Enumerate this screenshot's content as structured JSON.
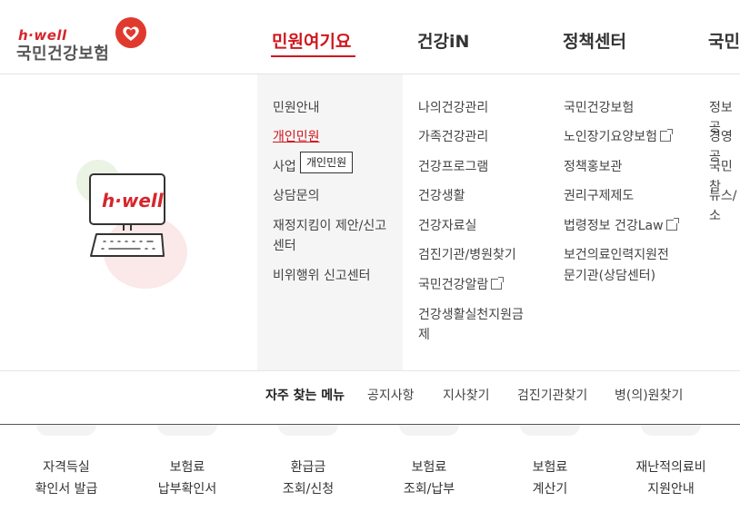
{
  "logo": {
    "sub": "h·well",
    "main": "국민건강보험"
  },
  "gnb": [
    {
      "label": "민원여기요"
    },
    {
      "label": "건강iN"
    },
    {
      "label": "정책센터"
    },
    {
      "label": "국민"
    }
  ],
  "menu": {
    "col1": [
      "민원안내",
      "개인민원",
      "사업",
      "상담문의",
      "재정지킴이 제안/신고",
      "센터",
      "비위행위 신고센터"
    ],
    "col2": [
      "나의건강관리",
      "가족건강관리",
      "건강프로그램",
      "건강생활",
      "건강자료실",
      "검진기관/병원찾기",
      "국민건강알람",
      "건강생활실천지원금",
      "제"
    ],
    "col3": [
      "국민건강보험",
      "노인장기요양보험",
      "정책홍보관",
      "권리구제제도",
      "법령정보 건강Law",
      "보건의료인력지원전",
      "문기관(상담센터)"
    ],
    "col4": [
      "정보공",
      "경영공",
      "국민참",
      "뉴스/소"
    ]
  },
  "tooltip": "개인민원",
  "illustration": {
    "screen_text": "h·well"
  },
  "quick": {
    "title": "자주 찾는 메뉴",
    "links": [
      "공지사항",
      "지사찾기",
      "검진기관찾기",
      "병(의)원찾기"
    ]
  },
  "services": [
    {
      "line1": "자격득실",
      "line2": "확인서 발급"
    },
    {
      "line1": "보험료",
      "line2": "납부확인서"
    },
    {
      "line1": "환급금",
      "line2": "조회/신청"
    },
    {
      "line1": "보험료",
      "line2": "조회/납부"
    },
    {
      "line1": "보험료",
      "line2": "계산기"
    },
    {
      "line1": "재난적의료비",
      "line2": "지원안내"
    }
  ],
  "colors": {
    "accent": "#d0161d",
    "gray_bg": "#f5f5f6"
  }
}
